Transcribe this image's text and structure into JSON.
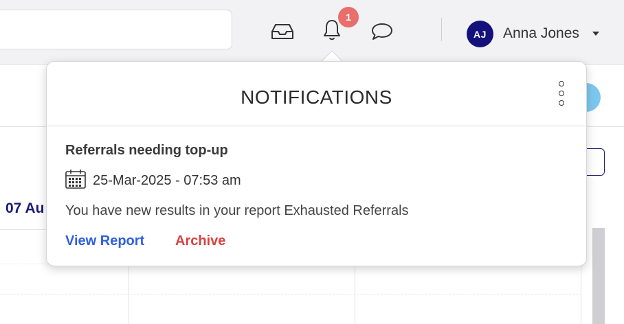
{
  "header": {
    "search_value": "",
    "notification_count": "1",
    "user": {
      "initials": "AJ",
      "name": "Anna Jones"
    },
    "icons": [
      "inbox-icon",
      "bell-icon",
      "chat-icon",
      "caret-down-icon"
    ]
  },
  "background": {
    "calendar_header_fragment": "07 Au"
  },
  "notifications": {
    "title": "NOTIFICATIONS",
    "items": [
      {
        "title": "Referrals needing top-up",
        "datetime": "25-Mar-2025 - 07:53 am",
        "message": "You have new results in your report Exhausted Referrals",
        "actions": {
          "view": "View Report",
          "archive": "Archive"
        }
      }
    ]
  },
  "colors": {
    "badge": "#e86f6b",
    "avatar": "#14127a",
    "view_link": "#2f5fe0",
    "archive_link": "#d9413f"
  }
}
